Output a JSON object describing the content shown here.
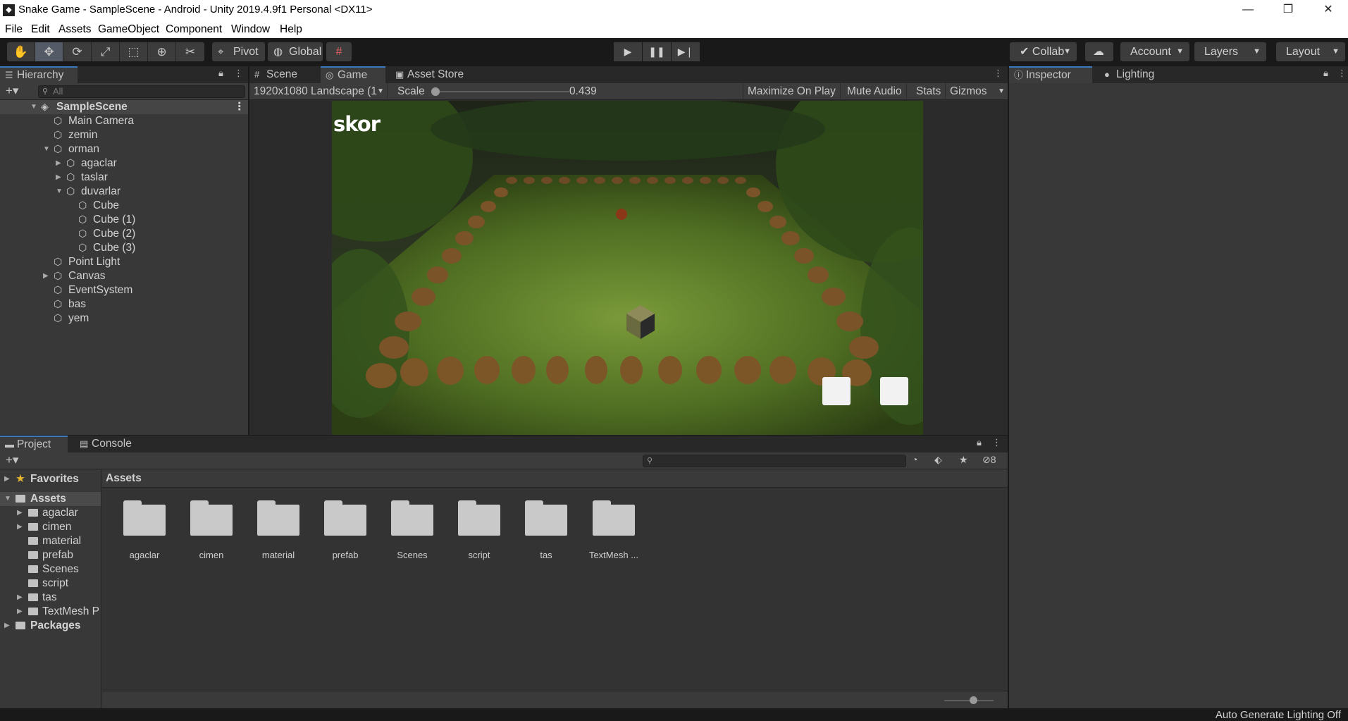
{
  "window": {
    "title": "Snake Game - SampleScene - Android - Unity 2019.4.9f1 Personal <DX11>",
    "minimize": "—",
    "restore": "❐",
    "close": "✕"
  },
  "menu": [
    "File",
    "Edit",
    "Assets",
    "GameObject",
    "Component",
    "Window",
    "Help"
  ],
  "toolbar": {
    "tools": [
      "hand-icon",
      "move-icon",
      "rotate-icon",
      "scale-icon",
      "rect-icon",
      "transform-icon",
      "custom-tool-icon"
    ],
    "pivot": "Pivot",
    "global": "Global",
    "collab": "Collab",
    "account": "Account",
    "layers": "Layers",
    "layout": "Layout"
  },
  "hierarchy": {
    "tab": "Hierarchy",
    "search_placeholder": "All",
    "scene": "SampleScene",
    "items": [
      {
        "label": "Main Camera"
      },
      {
        "label": "zemin"
      },
      {
        "label": "orman"
      },
      {
        "label": "agaclar"
      },
      {
        "label": "taslar"
      },
      {
        "label": "duvarlar"
      },
      {
        "label": "Cube"
      },
      {
        "label": "Cube (1)"
      },
      {
        "label": "Cube (2)"
      },
      {
        "label": "Cube (3)"
      },
      {
        "label": "Point Light"
      },
      {
        "label": "Canvas"
      },
      {
        "label": "EventSystem"
      },
      {
        "label": "bas"
      },
      {
        "label": "yem"
      }
    ]
  },
  "gameview": {
    "tabs": [
      "Scene",
      "Game",
      "Asset Store"
    ],
    "resolution": "1920x1080 Landscape (1",
    "scale_label": "Scale",
    "scale_value": "0.439",
    "maximize": "Maximize On Play",
    "mute": "Mute Audio",
    "stats": "Stats",
    "gizmos": "Gizmos",
    "score_text": "skor"
  },
  "inspector": {
    "tabs": [
      "Inspector",
      "Lighting"
    ]
  },
  "project": {
    "tabs": [
      "Project",
      "Console"
    ],
    "favorites": "Favorites",
    "assets_root": "Assets",
    "tree": [
      "agaclar",
      "cimen",
      "material",
      "prefab",
      "Scenes",
      "script",
      "tas",
      "TextMesh P"
    ],
    "packages": "Packages",
    "breadcrumb": "Assets",
    "hidden_count": "8",
    "grid": [
      "agaclar",
      "cimen",
      "material",
      "prefab",
      "Scenes",
      "script",
      "tas",
      "TextMesh ..."
    ]
  },
  "status": {
    "text": "Auto Generate Lighting Off"
  },
  "colors": {
    "accent": "#3a79bb",
    "panel": "#383838",
    "dark": "#191919"
  }
}
